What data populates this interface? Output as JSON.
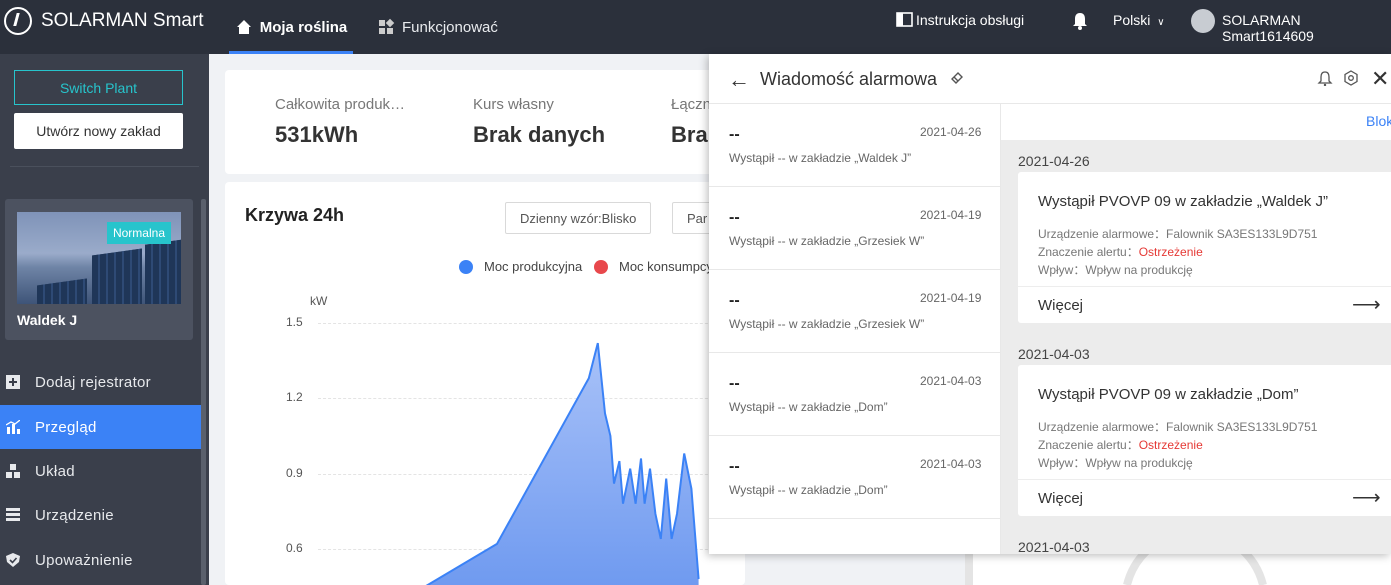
{
  "app": {
    "brand": "SOLARMAN Smart"
  },
  "nav": [
    {
      "label": "Moja roślina",
      "icon": "home-icon",
      "active": true
    },
    {
      "label": "Funkcjonować",
      "icon": "apps-icon",
      "active": false
    }
  ],
  "topbar": {
    "manual": "Instrukcja obsługi",
    "language": "Polski",
    "user": "SOLARMAN Smart1614609"
  },
  "sidebar": {
    "switch_plant": "Switch Plant",
    "new_plant": "Utwórz nowy zakład",
    "plant": {
      "status": "Normalna",
      "name": "Waldek J"
    },
    "menu": [
      {
        "label": "Dodaj rejestrator",
        "icon": "plus-square-icon"
      },
      {
        "label": "Przegląd",
        "icon": "chart-icon",
        "active": true
      },
      {
        "label": "Układ",
        "icon": "layout-icon"
      },
      {
        "label": "Urządzenie",
        "icon": "device-icon"
      },
      {
        "label": "Upoważnienie",
        "icon": "shield-icon"
      }
    ]
  },
  "summary": [
    {
      "label": "Całkowita produk…",
      "value": "531kWh"
    },
    {
      "label": "Kurs własny",
      "value": "Brak danych"
    },
    {
      "label": "Łączn",
      "value": "Bra"
    }
  ],
  "chart": {
    "title": "Krzywa 24h",
    "mode_button": "Dzienny wzór:Blisko",
    "mode_button2": "Par",
    "unit": "kW",
    "legend": [
      {
        "name": "Moc produkcyjna",
        "color": "#3b82f6"
      },
      {
        "name": "Moc konsumpcy",
        "color": "#e8484c"
      }
    ]
  },
  "chart_data": {
    "type": "area",
    "ylabel": "kW",
    "yticks": [
      1.5,
      1.2,
      0.9,
      0.6
    ],
    "series": [
      {
        "name": "Moc produkcyjna",
        "points": [
          [
            0,
            0.45
          ],
          [
            0.2,
            0.62
          ],
          [
            0.455,
            1.28
          ],
          [
            0.48,
            1.42
          ],
          [
            0.5,
            1.14
          ],
          [
            0.515,
            1.05
          ],
          [
            0.525,
            0.86
          ],
          [
            0.54,
            0.95
          ],
          [
            0.55,
            0.78
          ],
          [
            0.57,
            0.92
          ],
          [
            0.585,
            0.78
          ],
          [
            0.6,
            0.96
          ],
          [
            0.61,
            0.78
          ],
          [
            0.625,
            0.92
          ],
          [
            0.64,
            0.74
          ],
          [
            0.655,
            0.64
          ],
          [
            0.67,
            0.88
          ],
          [
            0.685,
            0.64
          ],
          [
            0.7,
            0.74
          ],
          [
            0.72,
            0.98
          ],
          [
            0.74,
            0.84
          ],
          [
            0.76,
            0.48
          ]
        ]
      }
    ]
  },
  "alarm_drawer": {
    "title": "Wiadomość alarmowa",
    "detail_link": "Blok",
    "list": [
      {
        "title": "--",
        "date": "2021-04-26",
        "desc": "Wystąpił -- w zakładzie „Waldek J”"
      },
      {
        "title": "--",
        "date": "2021-04-19",
        "desc": "Wystąpił -- w zakładzie „Grzesiek W”"
      },
      {
        "title": "--",
        "date": "2021-04-19",
        "desc": "Wystąpił -- w zakładzie „Grzesiek W”"
      },
      {
        "title": "--",
        "date": "2021-04-03",
        "desc": "Wystąpił -- w zakładzie „Dom”"
      },
      {
        "title": "--",
        "date": "2021-04-03",
        "desc": "Wystąpił -- w zakładzie „Dom”"
      }
    ],
    "groups": [
      {
        "date": "2021-04-26",
        "title": "Wystąpił PVOVP 09 w zakładzie „Waldek J”",
        "device": "Urządzenie alarmowe：Falownik SA3ES133L9D751",
        "significance_label": "Znaczenie alertu：",
        "significance_value": "Ostrzeżenie",
        "impact": "Wpływ：Wpływ na produkcję",
        "more": "Więcej"
      },
      {
        "date": "2021-04-03",
        "title": "Wystąpił PVOVP 09 w zakładzie „Dom”",
        "device": "Urządzenie alarmowe：Falownik SA3ES133L9D751",
        "significance_label": "Znaczenie alertu：",
        "significance_value": "Ostrzeżenie",
        "impact": "Wpływ：Wpływ na produkcję",
        "more": "Więcej"
      },
      {
        "date": "2021-04-03"
      }
    ]
  }
}
